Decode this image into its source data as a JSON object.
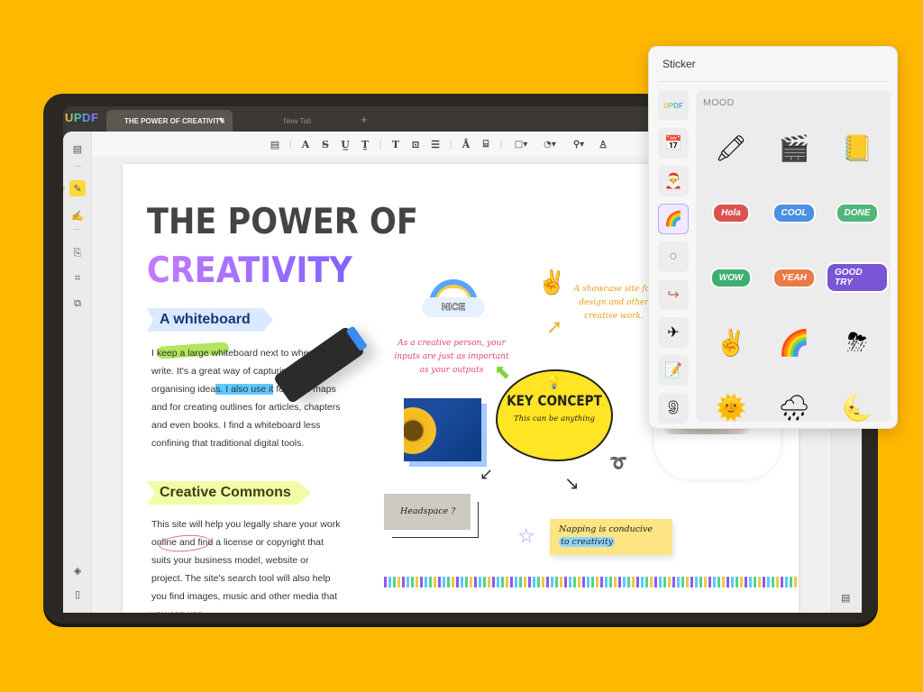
{
  "app": {
    "logo": "UPDF",
    "tabs": [
      {
        "label": "THE POWER OF CREATIVITY",
        "active": true
      },
      {
        "label": "New Tab",
        "active": false
      }
    ],
    "add_tab": "+",
    "edit_tab_glyph": "✎"
  },
  "left_rail": {
    "items": [
      {
        "name": "reader-icon",
        "glyph": "▤",
        "active": false
      },
      {
        "name": "comment-mode-icon",
        "glyph": "✎",
        "active": true
      },
      {
        "name": "edit-pdf-icon",
        "glyph": "✍",
        "active": false
      },
      {
        "name": "organize-pages-icon",
        "glyph": "⎘",
        "active": false
      },
      {
        "name": "crop-icon",
        "glyph": "⌗",
        "active": false
      },
      {
        "name": "convert-icon",
        "glyph": "⧉",
        "active": false
      }
    ],
    "bottom": [
      {
        "name": "layers-icon",
        "glyph": "◈"
      },
      {
        "name": "bookmark-icon",
        "glyph": "▯"
      }
    ]
  },
  "toolbar": {
    "tools": [
      {
        "name": "note-icon",
        "glyph": "▤"
      },
      {
        "name": "sep"
      },
      {
        "name": "highlight-icon",
        "glyph": "A"
      },
      {
        "name": "strikethrough-icon",
        "glyph": "S̶"
      },
      {
        "name": "underline-icon",
        "glyph": "U̲"
      },
      {
        "name": "squiggly-icon",
        "glyph": "T̰"
      },
      {
        "name": "sep"
      },
      {
        "name": "text-icon",
        "glyph": "T"
      },
      {
        "name": "textbox-icon",
        "glyph": "⊡"
      },
      {
        "name": "text-callout-icon",
        "glyph": "☰"
      },
      {
        "name": "sep"
      },
      {
        "name": "pencil-icon",
        "glyph": "Å"
      },
      {
        "name": "eraser-icon",
        "glyph": "⌸"
      },
      {
        "name": "sep"
      },
      {
        "name": "shape-icon",
        "glyph": "□▾"
      },
      {
        "name": "sticker-icon",
        "glyph": "◔▾"
      },
      {
        "name": "stamp-icon",
        "glyph": "⚲▾"
      },
      {
        "name": "signature-icon",
        "glyph": "♙"
      }
    ]
  },
  "document": {
    "title_line1": "THE POWER OF",
    "title_line2": "CREATIVITY",
    "section1": "A whiteboard",
    "para1_a": "I keep a large whiteboard next to where I write. It's a great way of capturing and organising idea",
    "para1_hl": "s. I also use it",
    "para1_b": " for mind maps and for creating outlines for articles, chapters and even books. I find a whiteboard less confining that traditional digital tools.",
    "section2": "Creative Commons",
    "para2": "This site will help you legally share your work online and find a license or copyright that suits your business model, website or project. The site's search tool will also help you find images, music and other media that you can use.",
    "nice_label": "NICE",
    "note_pink": "As a creative person, your inputs are just as important as your outputs",
    "note_orange": "A showcase site for design and other creative work.",
    "key_concept": "KEY CONCEPT",
    "key_concept_sub": "This can be anything",
    "headspace": "Headspace ?",
    "napping_1": "Napping is conducive",
    "napping_2": "to creativity"
  },
  "sticker_panel": {
    "title": "Sticker",
    "category_title": "MOOD",
    "categories": [
      {
        "name": "category-updf",
        "glyph": "UPDF",
        "active": false
      },
      {
        "name": "category-calendar",
        "glyph": "📅",
        "active": false
      },
      {
        "name": "category-holiday",
        "glyph": "🎅",
        "active": false
      },
      {
        "name": "category-mood",
        "glyph": "🌈",
        "active": true
      },
      {
        "name": "category-circle",
        "glyph": "○",
        "active": false
      },
      {
        "name": "category-arrow",
        "glyph": "↪",
        "active": false
      },
      {
        "name": "category-paper-plane",
        "glyph": "✈",
        "active": false
      },
      {
        "name": "category-note",
        "glyph": "📝",
        "active": false
      },
      {
        "name": "category-number",
        "glyph": "9",
        "active": false
      }
    ],
    "stickers": [
      {
        "name": "sticker-highlighter",
        "type": "emoji",
        "glyph": "🖍"
      },
      {
        "name": "sticker-behind-scenes",
        "type": "emoji",
        "glyph": "🎬"
      },
      {
        "name": "sticker-notepad",
        "type": "emoji",
        "glyph": "📒"
      },
      {
        "name": "sticker-hola",
        "type": "badge",
        "label": "Hola",
        "color": "#d9534f"
      },
      {
        "name": "sticker-cool",
        "type": "badge",
        "label": "COOL",
        "color": "#4a8fe0"
      },
      {
        "name": "sticker-done",
        "type": "badge",
        "label": "DONE",
        "color": "#52b57a"
      },
      {
        "name": "sticker-wow",
        "type": "badge",
        "label": "WOW",
        "color": "#3fae72"
      },
      {
        "name": "sticker-yeah",
        "type": "badge",
        "label": "YEAH",
        "color": "#ec7a46"
      },
      {
        "name": "sticker-good-try",
        "type": "badge",
        "label": "GOOD TRY",
        "color": "#7a55d6"
      },
      {
        "name": "sticker-peace",
        "type": "emoji",
        "glyph": "✌️"
      },
      {
        "name": "sticker-nice-rainbow",
        "type": "emoji",
        "glyph": "🌈"
      },
      {
        "name": "sticker-storm-cloud",
        "type": "emoji",
        "glyph": "⛈"
      },
      {
        "name": "sticker-sun",
        "type": "emoji",
        "glyph": "🌞"
      },
      {
        "name": "sticker-rain-cloud",
        "type": "emoji",
        "glyph": "🌧"
      },
      {
        "name": "sticker-moon",
        "type": "emoji",
        "glyph": "🌜"
      }
    ]
  }
}
